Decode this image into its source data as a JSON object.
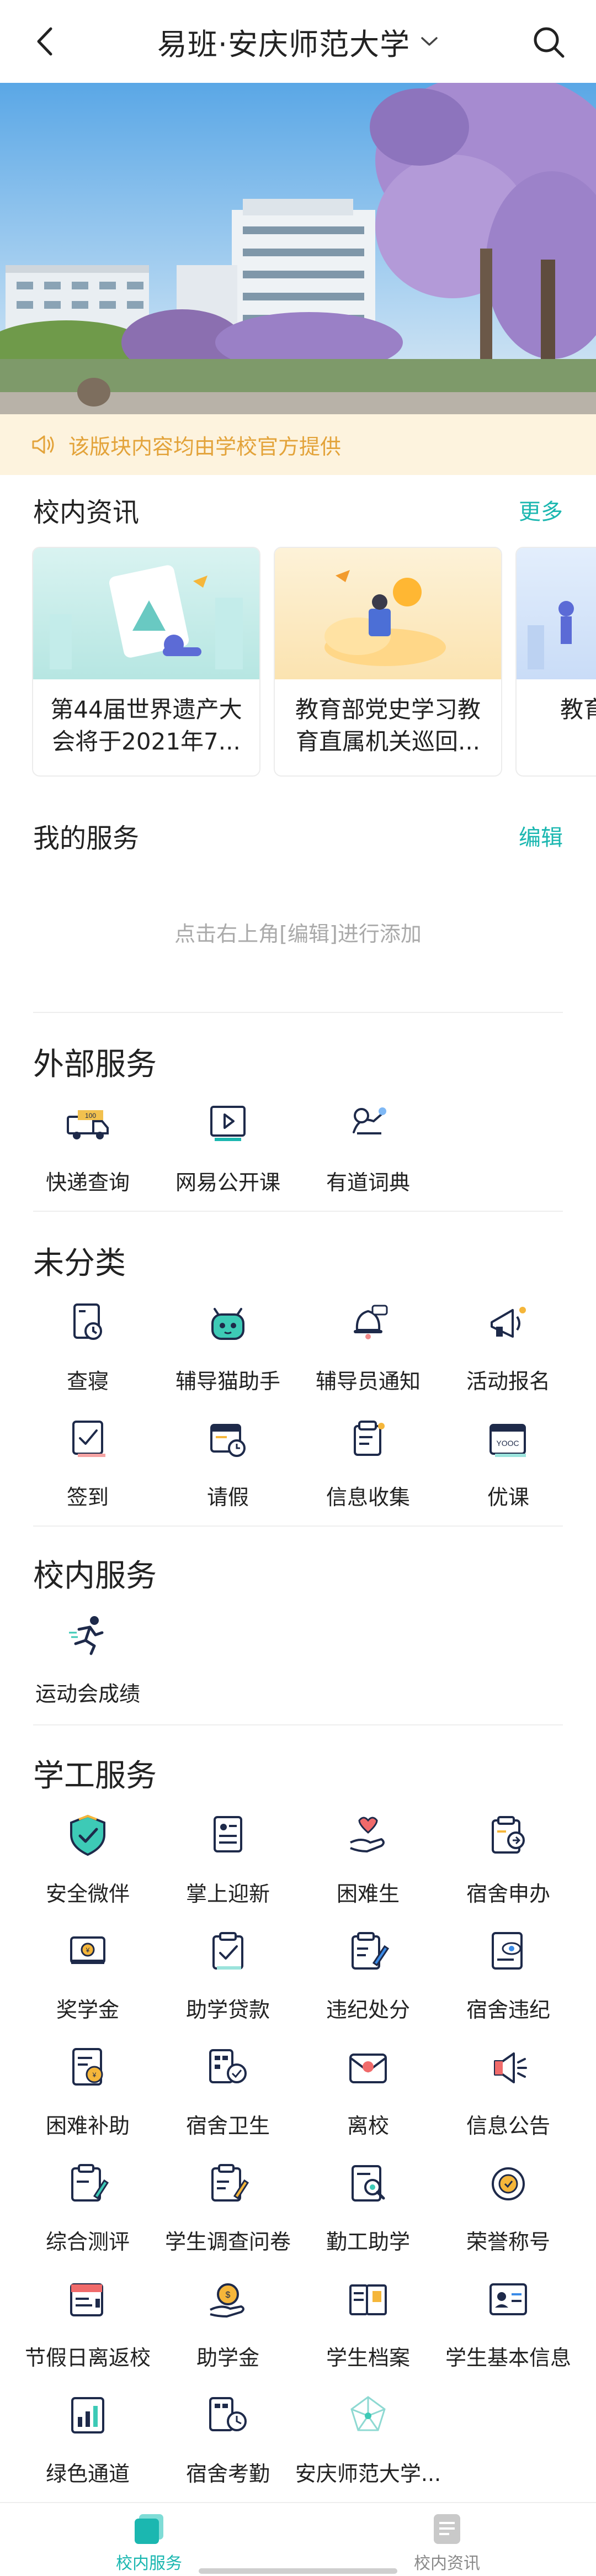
{
  "header": {
    "title": "易班·安庆师范大学",
    "back_icon": "back-arrow-icon",
    "search_icon": "search-icon",
    "dropdown_icon": "chevron-down-icon"
  },
  "notice": {
    "icon": "speaker-icon",
    "text": "该版块内容均由学校官方提供"
  },
  "news": {
    "title": "校内资讯",
    "more": "更多",
    "cards": [
      {
        "text": "第44届世界遗产大会将于2021年7..."
      },
      {
        "text": "教育部党史学习教育直属机关巡回..."
      },
      {
        "text": "教育部年全国"
      }
    ]
  },
  "my_services": {
    "title": "我的服务",
    "edit": "编辑",
    "placeholder": "点击右上角[编辑]进行添加"
  },
  "external": {
    "title": "外部服务",
    "items": [
      {
        "label": "快递查询",
        "icon": "delivery-truck-icon"
      },
      {
        "label": "网易公开课",
        "icon": "video-play-icon"
      },
      {
        "label": "有道词典",
        "icon": "dictionary-icon"
      }
    ]
  },
  "uncategorized": {
    "title": "未分类",
    "items": [
      {
        "label": "查寝",
        "icon": "dorm-check-icon"
      },
      {
        "label": "辅导猫助手",
        "icon": "robot-cat-icon"
      },
      {
        "label": "辅导员通知",
        "icon": "notification-bell-icon"
      },
      {
        "label": "活动报名",
        "icon": "megaphone-icon"
      },
      {
        "label": "签到",
        "icon": "sign-in-icon"
      },
      {
        "label": "请假",
        "icon": "leave-calendar-icon"
      },
      {
        "label": "信息收集",
        "icon": "info-collect-icon"
      },
      {
        "label": "优课",
        "icon": "yooc-calendar-icon"
      }
    ]
  },
  "campus": {
    "title": "校内服务",
    "items": [
      {
        "label": "运动会成绩",
        "icon": "runner-icon"
      }
    ]
  },
  "student_affairs": {
    "title": "学工服务",
    "items": [
      {
        "label": "安全微伴",
        "icon": "shield-check-icon"
      },
      {
        "label": "掌上迎新",
        "icon": "newcomer-doc-icon"
      },
      {
        "label": "困难生",
        "icon": "heart-hand-icon"
      },
      {
        "label": "宿舍申办",
        "icon": "dorm-apply-icon"
      },
      {
        "label": "奖学金",
        "icon": "scholarship-icon"
      },
      {
        "label": "助学贷款",
        "icon": "loan-clipboard-icon"
      },
      {
        "label": "违纪处分",
        "icon": "discipline-icon"
      },
      {
        "label": "宿舍违纪",
        "icon": "dorm-violation-icon"
      },
      {
        "label": "困难补助",
        "icon": "subsidy-icon"
      },
      {
        "label": "宿舍卫生",
        "icon": "dorm-hygiene-icon"
      },
      {
        "label": "离校",
        "icon": "leave-school-icon"
      },
      {
        "label": "信息公告",
        "icon": "announcement-icon"
      },
      {
        "label": "综合测评",
        "icon": "evaluation-icon"
      },
      {
        "label": "学生调查问卷",
        "icon": "survey-icon"
      },
      {
        "label": "勤工助学",
        "icon": "work-study-icon"
      },
      {
        "label": "荣誉称号",
        "icon": "medal-icon"
      },
      {
        "label": "节假日离返校",
        "icon": "holiday-icon"
      },
      {
        "label": "助学金",
        "icon": "grant-icon"
      },
      {
        "label": "学生档案",
        "icon": "archive-book-icon"
      },
      {
        "label": "学生基本信息",
        "icon": "student-id-icon"
      },
      {
        "label": "绿色通道",
        "icon": "green-channel-icon"
      },
      {
        "label": "宿舍考勤",
        "icon": "dorm-attendance-icon"
      },
      {
        "label": "安庆师范大学...",
        "icon": "network-logo-icon"
      }
    ]
  },
  "bottom_nav": [
    {
      "label": "校内服务",
      "icon": "campus-service-icon",
      "active": true
    },
    {
      "label": "校内资讯",
      "icon": "campus-news-icon",
      "active": false
    }
  ],
  "colors": {
    "accent": "#1bb7b0",
    "notice_bg": "#fdf3de",
    "notice_text": "#e3a33a"
  }
}
